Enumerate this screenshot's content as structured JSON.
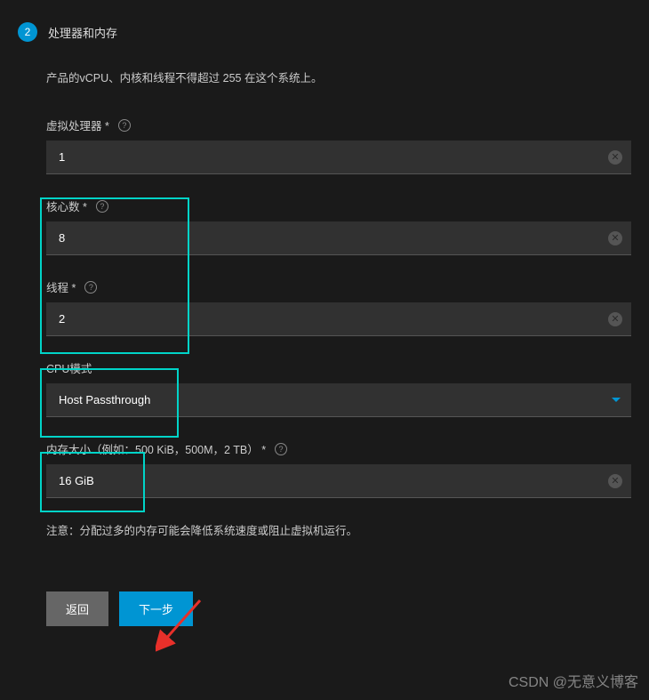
{
  "step": {
    "number": "2",
    "title": "处理器和内存"
  },
  "description": "产品的vCPU、内核和线程不得超过 255 在这个系统上。",
  "fields": {
    "vcpu": {
      "label": "虚拟处理器 *",
      "value": "1"
    },
    "cores": {
      "label": "核心数 *",
      "value": "8"
    },
    "threads": {
      "label": "线程 *",
      "value": "2"
    },
    "cpu_mode": {
      "label": "CPU模式",
      "value": "Host Passthrough"
    },
    "memory": {
      "label": "内存大小（例如：500 KiB，500M，2 TB） *",
      "value": "16 GiB"
    }
  },
  "note": "注意：分配过多的内存可能会降低系统速度或阻止虚拟机运行。",
  "buttons": {
    "back": "返回",
    "next": "下一步"
  },
  "watermark": "CSDN @无意义博客"
}
